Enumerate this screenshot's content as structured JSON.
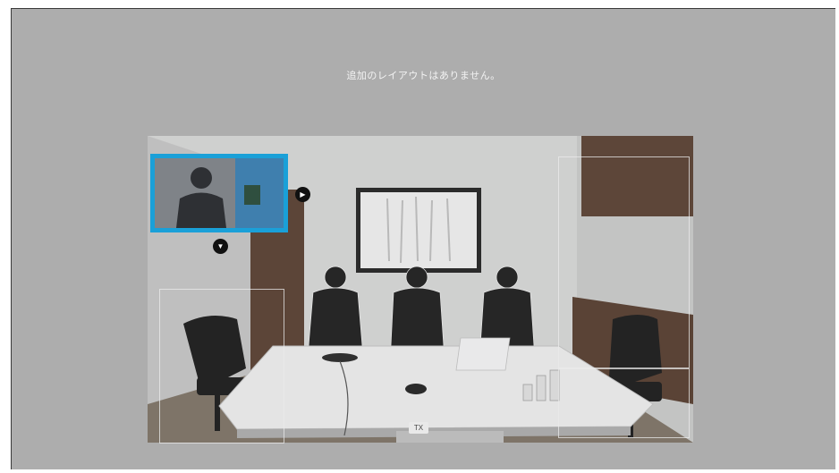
{
  "message": "追加のレイアウトはありません。",
  "pip": {
    "arrow_right_icon": "chevron-right",
    "arrow_down_icon": "chevron-down",
    "border_color": "#1aa0d8"
  },
  "table_label": "TX"
}
